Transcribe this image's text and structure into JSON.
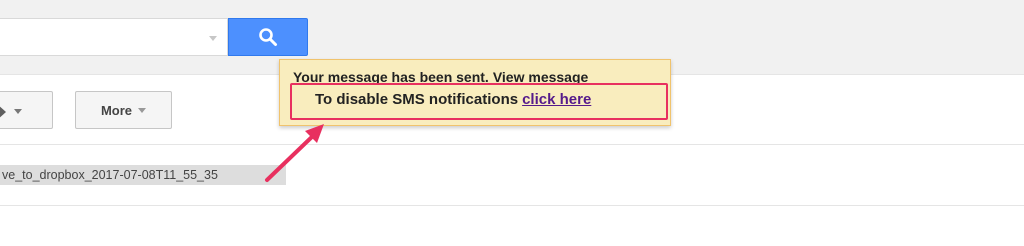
{
  "search": {
    "value": "",
    "button_icon": "search-icon"
  },
  "toolbar": {
    "label_button_icon": "label-icon",
    "more_label": "More"
  },
  "message_list": {
    "file_chip": "ve_to_dropbox_2017-07-08T11_55_35"
  },
  "notification": {
    "sent_text": "Your message has been sent.",
    "view_message_link": "View message",
    "sms_text": "To disable SMS notifications",
    "click_here_link": "click here"
  },
  "annotation": {
    "highlight_color": "#e8305f",
    "arrow_color": "#e8305f"
  },
  "colors": {
    "search_button": "#4d90fe",
    "notice_background": "#f9edbe",
    "link_visited": "#551a8b"
  }
}
